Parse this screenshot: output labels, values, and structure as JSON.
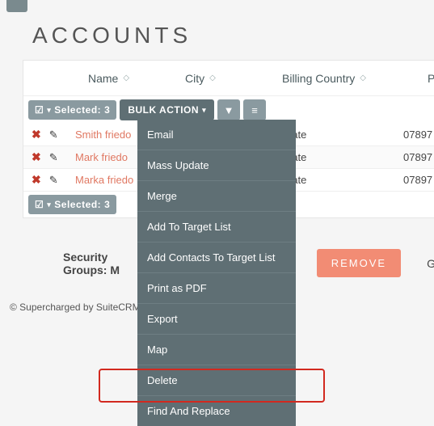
{
  "page_title": "ACCOUNTS",
  "columns": {
    "name": "Name",
    "city": "City",
    "country": "Billing Country",
    "phone": "Phone"
  },
  "selected": {
    "label": "Selected:",
    "count": "3"
  },
  "bulk_action_label": "BULK ACTION",
  "rows": [
    {
      "name": "Smith friedo",
      "city": "",
      "country": "State",
      "phone": "07897"
    },
    {
      "name": "Mark friedo",
      "city": "",
      "country": "State",
      "phone": "07897"
    },
    {
      "name": "Marka friedo",
      "city": "",
      "country": "State",
      "phone": "07897"
    }
  ],
  "dropdown_items": [
    "Email",
    "Mass Update",
    "Merge",
    "Add To Target List",
    "Add Contacts To Target List",
    "Print as PDF",
    "Export",
    "Map",
    "Delete",
    "Find And Replace"
  ],
  "security_label": "Security Groups: M",
  "remove_label": "REMOVE",
  "group_label": "Group",
  "footer": "© Supercharged by SuiteCRM"
}
